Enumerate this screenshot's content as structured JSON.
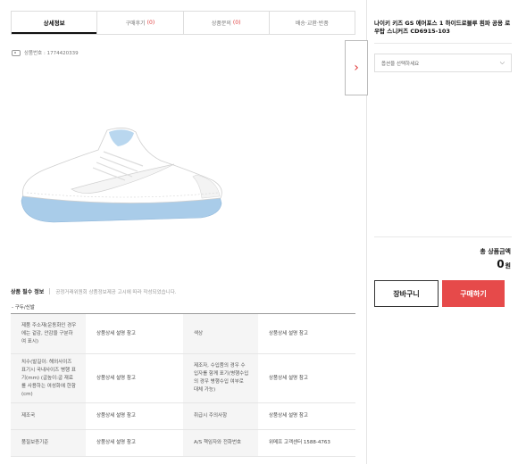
{
  "tabs": [
    {
      "label": "상세정보",
      "count": ""
    },
    {
      "label": "구매후기",
      "count": "(0)"
    },
    {
      "label": "상품문의",
      "count": "(0)"
    },
    {
      "label": "배송·교환·반품",
      "count": ""
    }
  ],
  "product_no": "상품번호 : 1774420339",
  "panel_toggle_icon": "chevron-right-icon",
  "spec": {
    "title": "상품 필수 정보",
    "note": "공정거래위원회 상품정보제공 고시에 따라 작성되었습니다.",
    "category": "- 구두/신발",
    "rows": [
      {
        "l1": "제품 주소재(운동화인 경우에는 겉감, 안감을 구분하여 표시)",
        "v1": "상품상세 설명 참고",
        "l2": "색상",
        "v2": "상품상세 설명 참고"
      },
      {
        "l1": "치수(발길이: 해외사이즈 표기시 국내사이즈 병행 표기(mm) (굽높이:굽 재료를 사용하는 여성화에 한함(cm)",
        "v1": "상품상세 설명 참고",
        "l2": "제조자, 수입품의 경우 수입자를 함께 표기(병행수입의 경우 병행수입 여부로 대체 가능)",
        "v2": "상품상세 설명 참고"
      },
      {
        "l1": "제조국",
        "v1": "상품상세 설명 참고",
        "l2": "취급시 주의사항",
        "v2": "상품상세 설명 참고"
      },
      {
        "l1": "품질보증기준",
        "v1": "상품상세 설명 참고",
        "l2": "A/S 책임자와 전화번호",
        "v2": "위메프 고객센터 1588-4763"
      }
    ]
  },
  "sidebar": {
    "product_title": "나이키 키즈 GS 에어포스 1 하이드로블루 흰파 공용 로우탑 스니커즈 CD6915-103",
    "option_placeholder": "옵션을 선택하세요",
    "total_label": "총 상품금액",
    "total_value": "0",
    "currency": "원",
    "cart_label": "장바구니",
    "buy_label": "구매하기"
  },
  "colors": {
    "accent_red": "#e64a4a",
    "count_red": "#e03a3a",
    "shoe_sole_blue": "#a9cce9"
  }
}
